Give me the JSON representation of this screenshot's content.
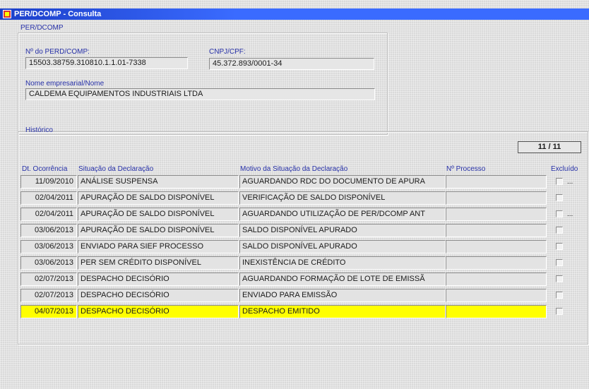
{
  "window": {
    "title": "PER/DCOMP - Consulta"
  },
  "perdcomp_group": {
    "label": "PER/DCOMP",
    "numero_label": "Nº do PERD/COMP:",
    "numero_value": "15503.38759.310810.1.1.01-7338",
    "cnpj_label": "CNPJ/CPF:",
    "cnpj_value": "45.372.893/0001-34",
    "nome_label": "Nome empresarial/Nome",
    "nome_value": "CALDEMA EQUIPAMENTOS INDUSTRIAIS LTDA"
  },
  "historico": {
    "label": "Histórico",
    "counter": "11 / 11",
    "headers": {
      "date": "Dt. Ocorrência",
      "situacao": "Situação da Declaração",
      "motivo": "Motivo da Situação da Declaração",
      "processo": "Nº Processo",
      "excluido": "Excluído"
    },
    "rows": [
      {
        "date": "11/09/2010",
        "situacao": "ANÁLISE SUSPENSA",
        "motivo": "AGUARDANDO RDC DO DOCUMENTO DE APURA",
        "processo": "",
        "dots": "..."
      },
      {
        "date": "02/04/2011",
        "situacao": "APURAÇÃO DE SALDO DISPONÍVEL",
        "motivo": "VERIFICAÇÃO DE SALDO DISPONÍVEL",
        "processo": "",
        "dots": ""
      },
      {
        "date": "02/04/2011",
        "situacao": "APURAÇÃO DE SALDO DISPONÍVEL",
        "motivo": "AGUARDANDO UTILIZAÇÃO DE PER/DCOMP ANT",
        "processo": "",
        "dots": "..."
      },
      {
        "date": "03/06/2013",
        "situacao": "APURAÇÃO DE SALDO DISPONÍVEL",
        "motivo": "SALDO DISPONÍVEL APURADO",
        "processo": "",
        "dots": ""
      },
      {
        "date": "03/06/2013",
        "situacao": "ENVIADO PARA SIEF PROCESSO",
        "motivo": "SALDO DISPONÍVEL APURADO",
        "processo": "",
        "dots": ""
      },
      {
        "date": "03/06/2013",
        "situacao": "PER SEM CRÉDITO DISPONÍVEL",
        "motivo": "INEXISTÊNCIA DE CRÉDITO",
        "processo": "",
        "dots": ""
      },
      {
        "date": "02/07/2013",
        "situacao": "DESPACHO DECISÓRIO",
        "motivo": "AGUARDANDO FORMAÇÃO DE LOTE DE EMISSÃ",
        "processo": "",
        "dots": ""
      },
      {
        "date": "02/07/2013",
        "situacao": "DESPACHO DECISÓRIO",
        "motivo": "ENVIADO PARA EMISSÃO",
        "processo": "",
        "dots": ""
      },
      {
        "date": "04/07/2013",
        "situacao": "DESPACHO DECISÓRIO",
        "motivo": "DESPACHO EMITIDO",
        "processo": "",
        "dots": "",
        "highlight": true
      }
    ]
  },
  "colors": {
    "title_bar": "#2f5cf0",
    "label_text": "#2630a8",
    "highlight_row": "#ffff00"
  }
}
